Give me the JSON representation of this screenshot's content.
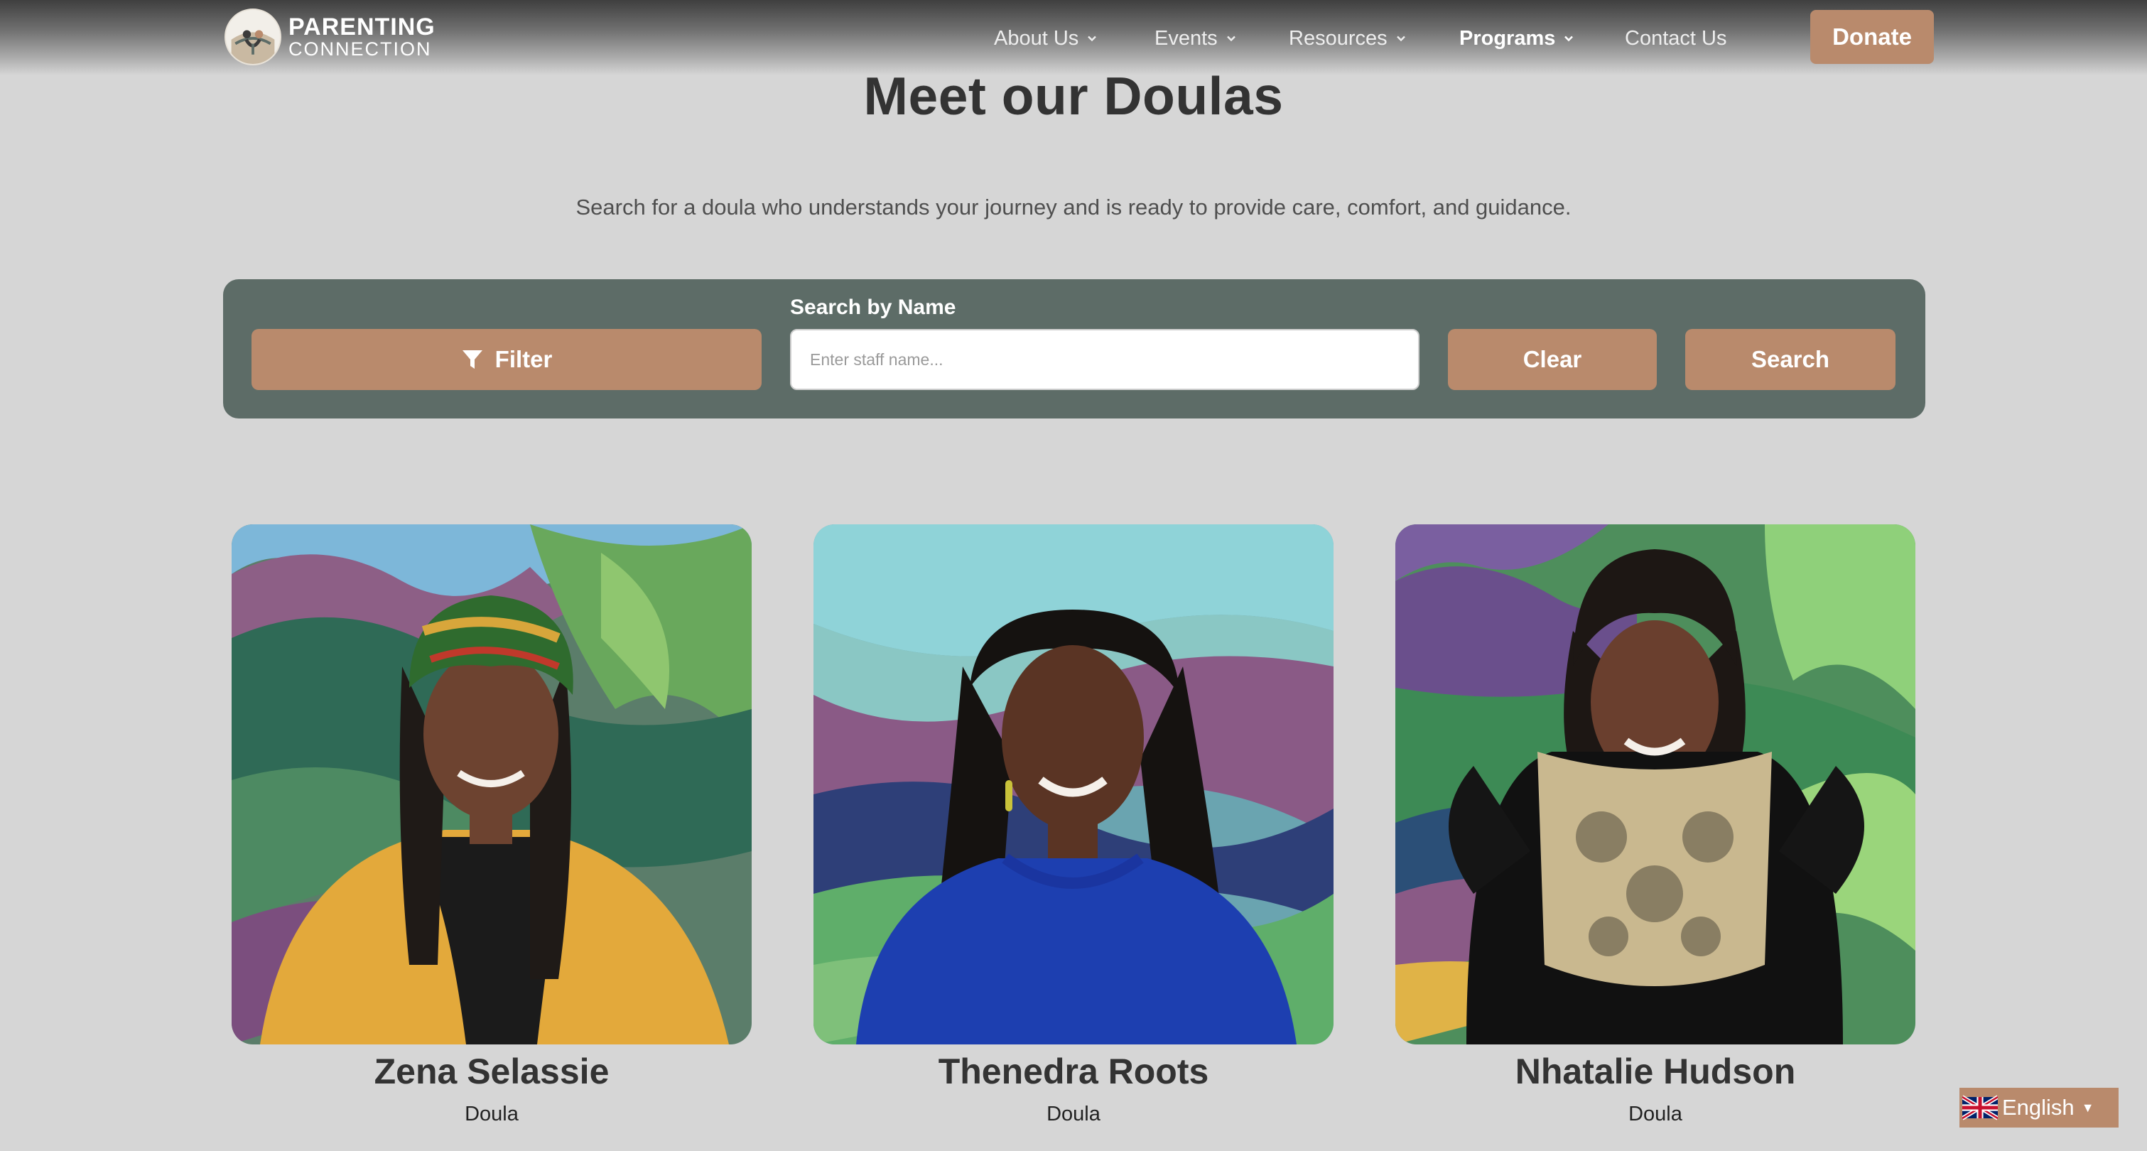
{
  "logo": {
    "line1": "PARENTING",
    "line2": "CONNECTION",
    "icon": "family-logo-icon"
  },
  "nav": [
    {
      "label": "About Us",
      "has_dropdown": true,
      "active": false
    },
    {
      "label": "Events",
      "has_dropdown": true,
      "active": false
    },
    {
      "label": "Resources",
      "has_dropdown": true,
      "active": false
    },
    {
      "label": "Programs",
      "has_dropdown": true,
      "active": true
    },
    {
      "label": "Contact Us",
      "has_dropdown": false,
      "active": false
    }
  ],
  "donate_label": "Donate",
  "page": {
    "title": "Meet our Doulas",
    "subtitle": "Search for a doula who understands your journey and is ready to provide care, comfort, and guidance."
  },
  "search": {
    "filter_label": "Filter",
    "label": "Search by Name",
    "value": "",
    "placeholder": "Enter staff name...",
    "clear_label": "Clear",
    "search_label": "Search"
  },
  "staff": [
    {
      "name": "Zena Selassie",
      "role": "Doula"
    },
    {
      "name": "Thenedra Roots",
      "role": "Doula"
    },
    {
      "name": "Nhatalie Hudson",
      "role": "Doula"
    }
  ],
  "language": {
    "label": "English",
    "flag": "uk-flag-icon"
  },
  "colors": {
    "accent": "#b98a6c",
    "panel": "#5d6c67",
    "background": "#d6d6d6",
    "text": "#333333"
  }
}
